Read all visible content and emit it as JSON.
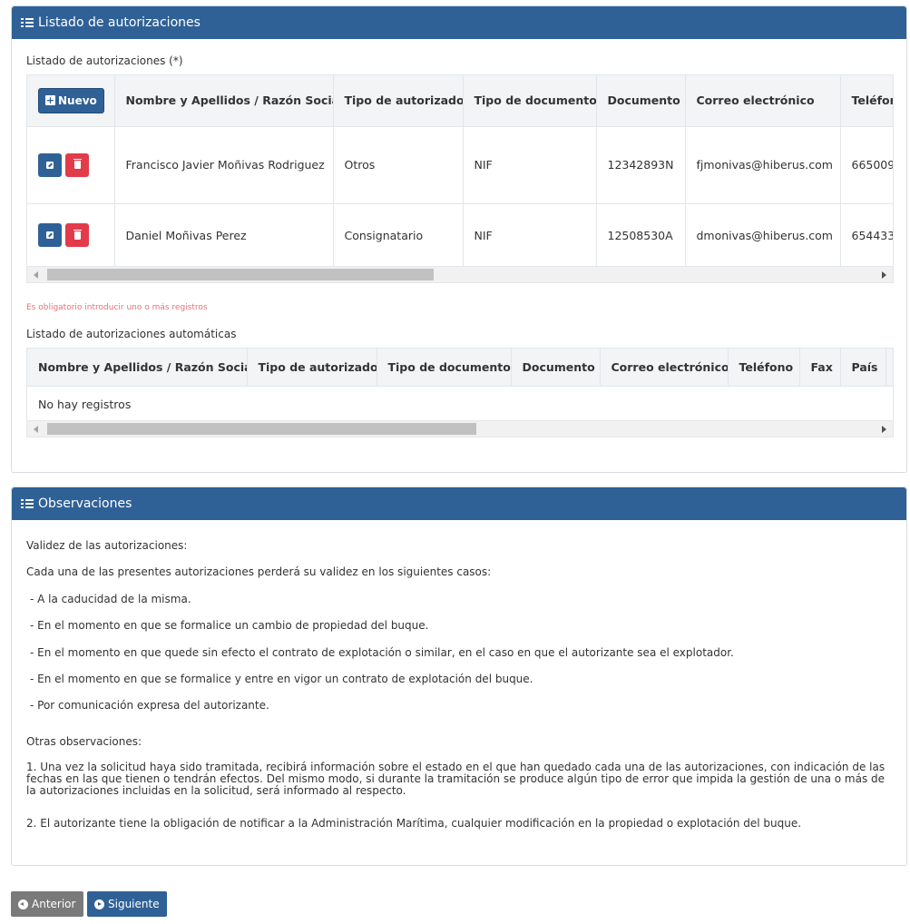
{
  "panel_autorizaciones": {
    "title": "Listado de autorizaciones",
    "table_label": "Listado de autorizaciones (*)",
    "new_button": "Nuevo",
    "columns": [
      "Nombre y Apellidos / Razón Social",
      "Tipo de autorizado",
      "Tipo de documento",
      "Documento",
      "Correo electrónico",
      "Teléfono"
    ],
    "rows": [
      {
        "nombre": "Francisco Javier Moñivas Rodriguez",
        "tipo_autorizado": "Otros",
        "tipo_documento": "NIF",
        "documento": "12342893N",
        "correo": "fjmonivas@hiberus.com",
        "telefono": "665009"
      },
      {
        "nombre": "Daniel Moñivas Perez",
        "tipo_autorizado": "Consignatario",
        "tipo_documento": "NIF",
        "documento": "12508530A",
        "correo": "dmonivas@hiberus.com",
        "telefono": "654433"
      }
    ],
    "error_message": "Es obligatorio introducir uno o más registros",
    "auto_label": "Listado de autorizaciones automáticas",
    "auto_columns": [
      "Nombre y Apellidos / Razón Social",
      "Tipo de autorizado",
      "Tipo de documento",
      "Documento",
      "Correo electrónico",
      "Teléfono",
      "Fax",
      "País"
    ],
    "auto_empty": "No hay registros"
  },
  "panel_observaciones": {
    "title": "Observaciones",
    "validity_heading": "Validez de las autorizaciones:",
    "validity_intro": "Cada una de las presentes autorizaciones perderá su validez en los siguientes casos:",
    "cases": [
      "- A la caducidad de la misma.",
      "- En el momento en que se formalice un cambio de propiedad del buque.",
      "- En el momento en que quede sin efecto el contrato de explotación o similar, en el caso en que el autorizante sea el explotador.",
      "- En el momento en que se formalice y entre en vigor un contrato de explotación del buque.",
      "- Por comunicación expresa del autorizante."
    ],
    "other_heading": "Otras observaciones:",
    "other_1": "1.  Una vez la solicitud haya sido tramitada, recibirá información sobre el estado en el que han quedado cada una de las autorizaciones, con indicación de las fechas en las que tienen o tendrán efectos. Del mismo modo, si durante la tramitación se produce algún tipo de error que impida la gestión de una o más de la autorizaciones incluidas en la solicitud, será informado al respecto.",
    "other_2": "2.  El autorizante tiene la obligación de notificar a la Administración Marítima, cualquier modificación en la propiedad o explotación del buque."
  },
  "nav": {
    "previous": "Anterior",
    "next": "Siguiente"
  },
  "colors": {
    "primary": "#2f6196",
    "danger": "#e23b4a",
    "secondary": "#7a7a7a",
    "error_text": "#e2737a"
  }
}
